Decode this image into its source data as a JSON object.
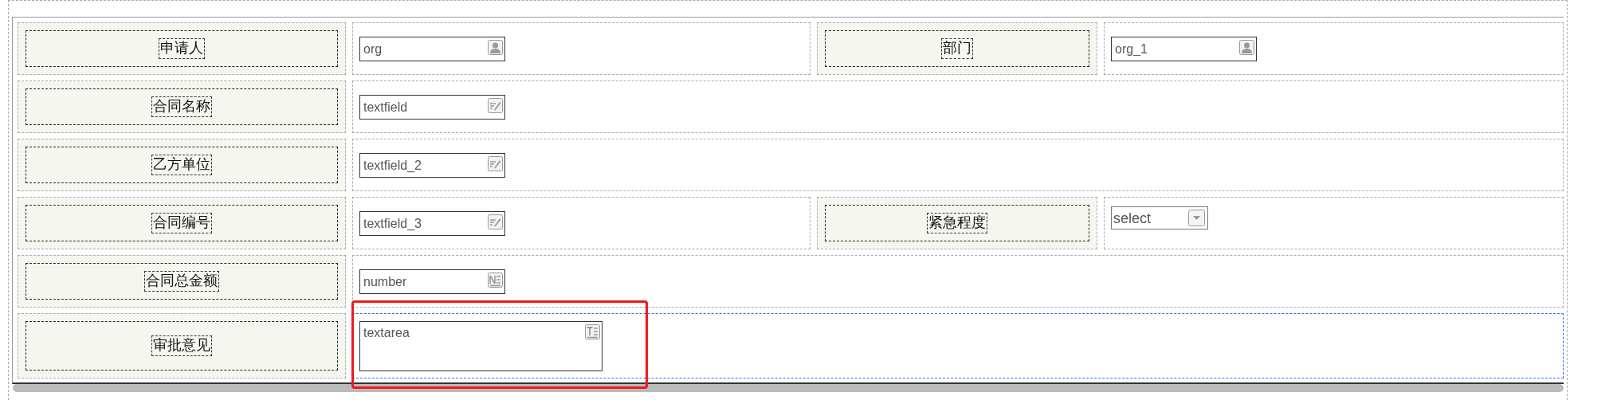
{
  "form": {
    "rows": [
      {
        "selected": false,
        "fields": [
          {
            "label": "申请人",
            "kind": "org",
            "value": "org",
            "highlighted": false
          },
          {
            "label": "部门",
            "kind": "org",
            "value": "org_1",
            "highlighted": false
          }
        ]
      },
      {
        "selected": false,
        "fields": [
          {
            "label": "合同名称",
            "kind": "text",
            "value": "textfield",
            "highlighted": false
          }
        ]
      },
      {
        "selected": false,
        "fields": [
          {
            "label": "乙方单位",
            "kind": "text",
            "value": "textfield_2",
            "highlighted": false
          }
        ]
      },
      {
        "selected": false,
        "fields": [
          {
            "label": "合同编号",
            "kind": "text",
            "value": "textfield_3",
            "highlighted": false
          },
          {
            "label": "紧急程度",
            "kind": "select",
            "value": "select",
            "highlighted": false
          }
        ]
      },
      {
        "selected": false,
        "fields": [
          {
            "label": "合同总金额",
            "kind": "number",
            "value": "number",
            "highlighted": false
          }
        ]
      },
      {
        "selected": true,
        "fields": [
          {
            "label": "审批意见",
            "kind": "textarea",
            "value": "textarea",
            "highlighted": true
          }
        ]
      }
    ]
  }
}
